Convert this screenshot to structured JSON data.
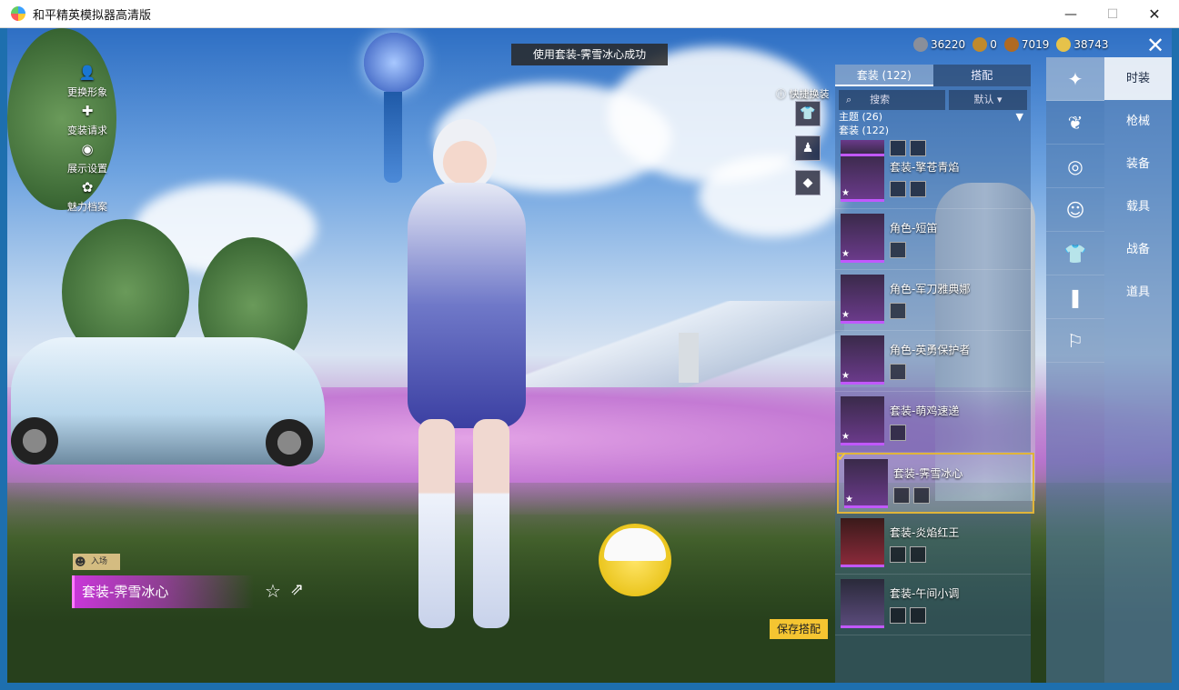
{
  "window": {
    "title": "和平精英模拟器高清版",
    "minimize": "—",
    "maximize": "☐",
    "close": "✕"
  },
  "hud_left": [
    {
      "label": "更换形象",
      "icon": "person-icon"
    },
    {
      "label": "变装请求",
      "icon": "puzzle-icon"
    },
    {
      "label": "展示设置",
      "icon": "eye-icon"
    },
    {
      "label": "魅力档案",
      "icon": "flame-icon"
    }
  ],
  "toast": "使用套装-霁雪冰心成功",
  "currencies": [
    {
      "value": "36220",
      "color": "#8a8f9a"
    },
    {
      "value": "0",
      "color": "#c08a2c"
    },
    {
      "value": "7019",
      "color": "#b06a22"
    },
    {
      "value": "38743",
      "color": "#e6c24a"
    }
  ],
  "close_button": "✕",
  "quick_switch": {
    "label": "快捷换装"
  },
  "panel": {
    "tabs": [
      "套装 (122)",
      "搭配"
    ],
    "search_icon": "⌕",
    "search_placeholder": "搜索",
    "sort": "默认 ▾",
    "filter_theme": "主题 (26)",
    "filter_arrow": "▼",
    "filter_outfit": "套装 (122)",
    "entries": [
      {
        "name": "套装-擎苍青焰",
        "minis": 2
      },
      {
        "name": "角色-短笛",
        "minis": 1
      },
      {
        "name": "角色-军刀雅典娜",
        "minis": 1
      },
      {
        "name": "角色-英勇保护者",
        "minis": 1
      },
      {
        "name": "套装-萌鸡速递",
        "minis": 1
      },
      {
        "name": "套装-霁雪冰心",
        "minis": 2,
        "selected": true
      },
      {
        "name": "套装-炎焰红王",
        "minis": 2
      },
      {
        "name": "套装-午间小调",
        "minis": 2
      }
    ]
  },
  "categories": [
    "时装",
    "枪械",
    "装备",
    "载具",
    "战备",
    "道具"
  ],
  "enter_badge": "入场",
  "current_outfit": "套装-霁雪冰心",
  "save_button": "保存搭配",
  "accent": "#c837d8",
  "selection_color": "#e0b43a"
}
